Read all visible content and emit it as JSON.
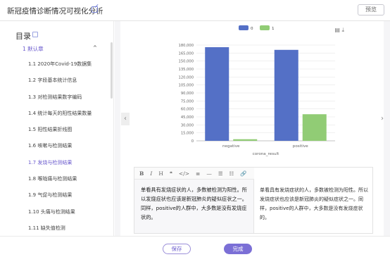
{
  "header": {
    "title": "新冠疫情诊断情况可视化分析",
    "preview_label": "预览"
  },
  "sidebar": {
    "toc_title": "目录",
    "chapter_label": "1 默认章",
    "chapter_caret": "^",
    "items": [
      {
        "label": "1.1 2020年Covid-19数据集"
      },
      {
        "label": "1.2 字段基本统计信息"
      },
      {
        "label": "1.3 对检测结果数字编码"
      },
      {
        "label": "1.4 统计每天的阳性结果数量"
      },
      {
        "label": "1.5 阳性结果折线图"
      },
      {
        "label": "1.6 咳嗽与检测结果"
      },
      {
        "label": "1.7 发烧与检测结果"
      },
      {
        "label": "1.8 喉咙痛与检测结果"
      },
      {
        "label": "1.9 气促与检测结果"
      },
      {
        "label": "1.10 头痛与检测结果"
      },
      {
        "label": "1.11 缺失值检测"
      }
    ]
  },
  "chart_data": {
    "type": "bar",
    "categories": [
      "negative",
      "positive"
    ],
    "series": [
      {
        "name": "0",
        "values": [
          176000,
          171000
        ],
        "color": "#5470c6"
      },
      {
        "name": "1",
        "values": [
          3000,
          50000
        ],
        "color": "#91cc75"
      }
    ],
    "xlabel": "corona_result",
    "ylabel": "",
    "ylim": [
      0,
      180000
    ],
    "yticks": [
      0,
      15000,
      30000,
      45000,
      60000,
      75000,
      90000,
      105000,
      120000,
      135000,
      150000,
      165000,
      180000
    ],
    "ytick_labels": [
      "0",
      "15,000",
      "30,000",
      "45,000",
      "60,000",
      "75,000",
      "90,000",
      "105,000",
      "120,000",
      "135,000",
      "150,000",
      "165,000",
      "180,000"
    ],
    "legend_position": "top-center",
    "grid": true
  },
  "chart_tools": {
    "doc_icon": "document-icon",
    "download_icon": "download-icon"
  },
  "editor": {
    "toolbar": [
      "B",
      "I",
      "H",
      "❝",
      "</>",
      "≣",
      "—",
      "☰",
      "☷",
      "🔗"
    ],
    "text": "单看具有发烧症状的人，多数被检测为阳性。所以发烧症状也应该是新冠肺炎的疑似症状之一。同样，positive的人群中，大多数是没有发烧症状的。"
  },
  "footer": {
    "save_label": "保存",
    "done_label": "完成"
  },
  "nav": {
    "left": "‹",
    "right": "›"
  },
  "colors": {
    "accent": "#6a5acd",
    "bar_series_0": "#5470c6",
    "bar_series_1": "#91cc75"
  }
}
